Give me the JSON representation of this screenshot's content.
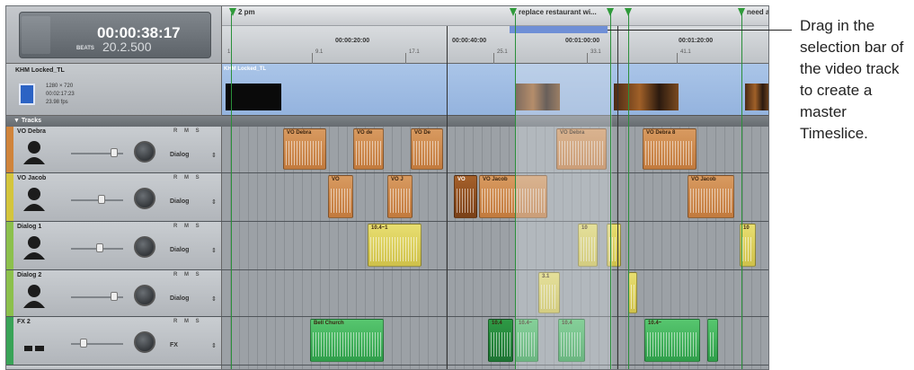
{
  "header": {
    "timecode": "00:00:38:17",
    "timecode_prefix": "",
    "beats_label": "BEATS",
    "beats_value": "20.2.500"
  },
  "markers": [
    {
      "label": "2 pm"
    },
    {
      "label": "replace restaurant wi..."
    },
    {
      "label": ""
    },
    {
      "label": ""
    },
    {
      "label": "need a"
    }
  ],
  "ruler": {
    "labels": [
      "00:00:20:00",
      "00:00:40:00",
      "00:01:00:00",
      "00:01:20:00"
    ],
    "sub_labels": [
      "1",
      "9.1",
      "17.1",
      "25.1",
      "33.1",
      "41.1"
    ]
  },
  "video_track": {
    "name": "KHM Locked_TL",
    "resolution": "1280 × 720",
    "duration": "00:02:17:23",
    "fps": "23.98 fps",
    "clip_label": "KHM Locked_TL"
  },
  "tracks_header": "▼ Tracks",
  "tracks": [
    {
      "name": "VO Debra",
      "output": "Dialog",
      "color": "#d0843b",
      "clips": [
        "VO Debra",
        "VO de",
        "VO De",
        "VO Debra",
        "VO Debra 8"
      ]
    },
    {
      "name": "VO Jacob",
      "output": "Dialog",
      "color": "#d4c53c",
      "clips": [
        "VO",
        "VO J",
        "VO",
        "VO Jacob",
        "VO Jacob"
      ]
    },
    {
      "name": "Dialog 1",
      "output": "Dialog",
      "color": "#8cc04c",
      "clips": [
        "10.4~1",
        "10",
        "",
        "10"
      ]
    },
    {
      "name": "Dialog 2",
      "output": "Dialog",
      "color": "#8cc04c",
      "clips": [
        "3.1",
        ""
      ]
    },
    {
      "name": "FX 2",
      "output": "FX",
      "color": "#39a357",
      "clips": [
        "Bell Church",
        "10.4",
        "10.4~",
        "10.4",
        "10.4~"
      ]
    }
  ],
  "track_buttons": "R M S",
  "callout": {
    "text": "Drag in the selection bar of the video track to create a master Timeslice."
  },
  "colors": {
    "marker_green": "#2f9b3a",
    "selection_bar": "#6f8fd6",
    "clip_orange": "#c27a3d",
    "clip_yellow": "#cfc14a",
    "clip_green": "#2f9e4a"
  }
}
